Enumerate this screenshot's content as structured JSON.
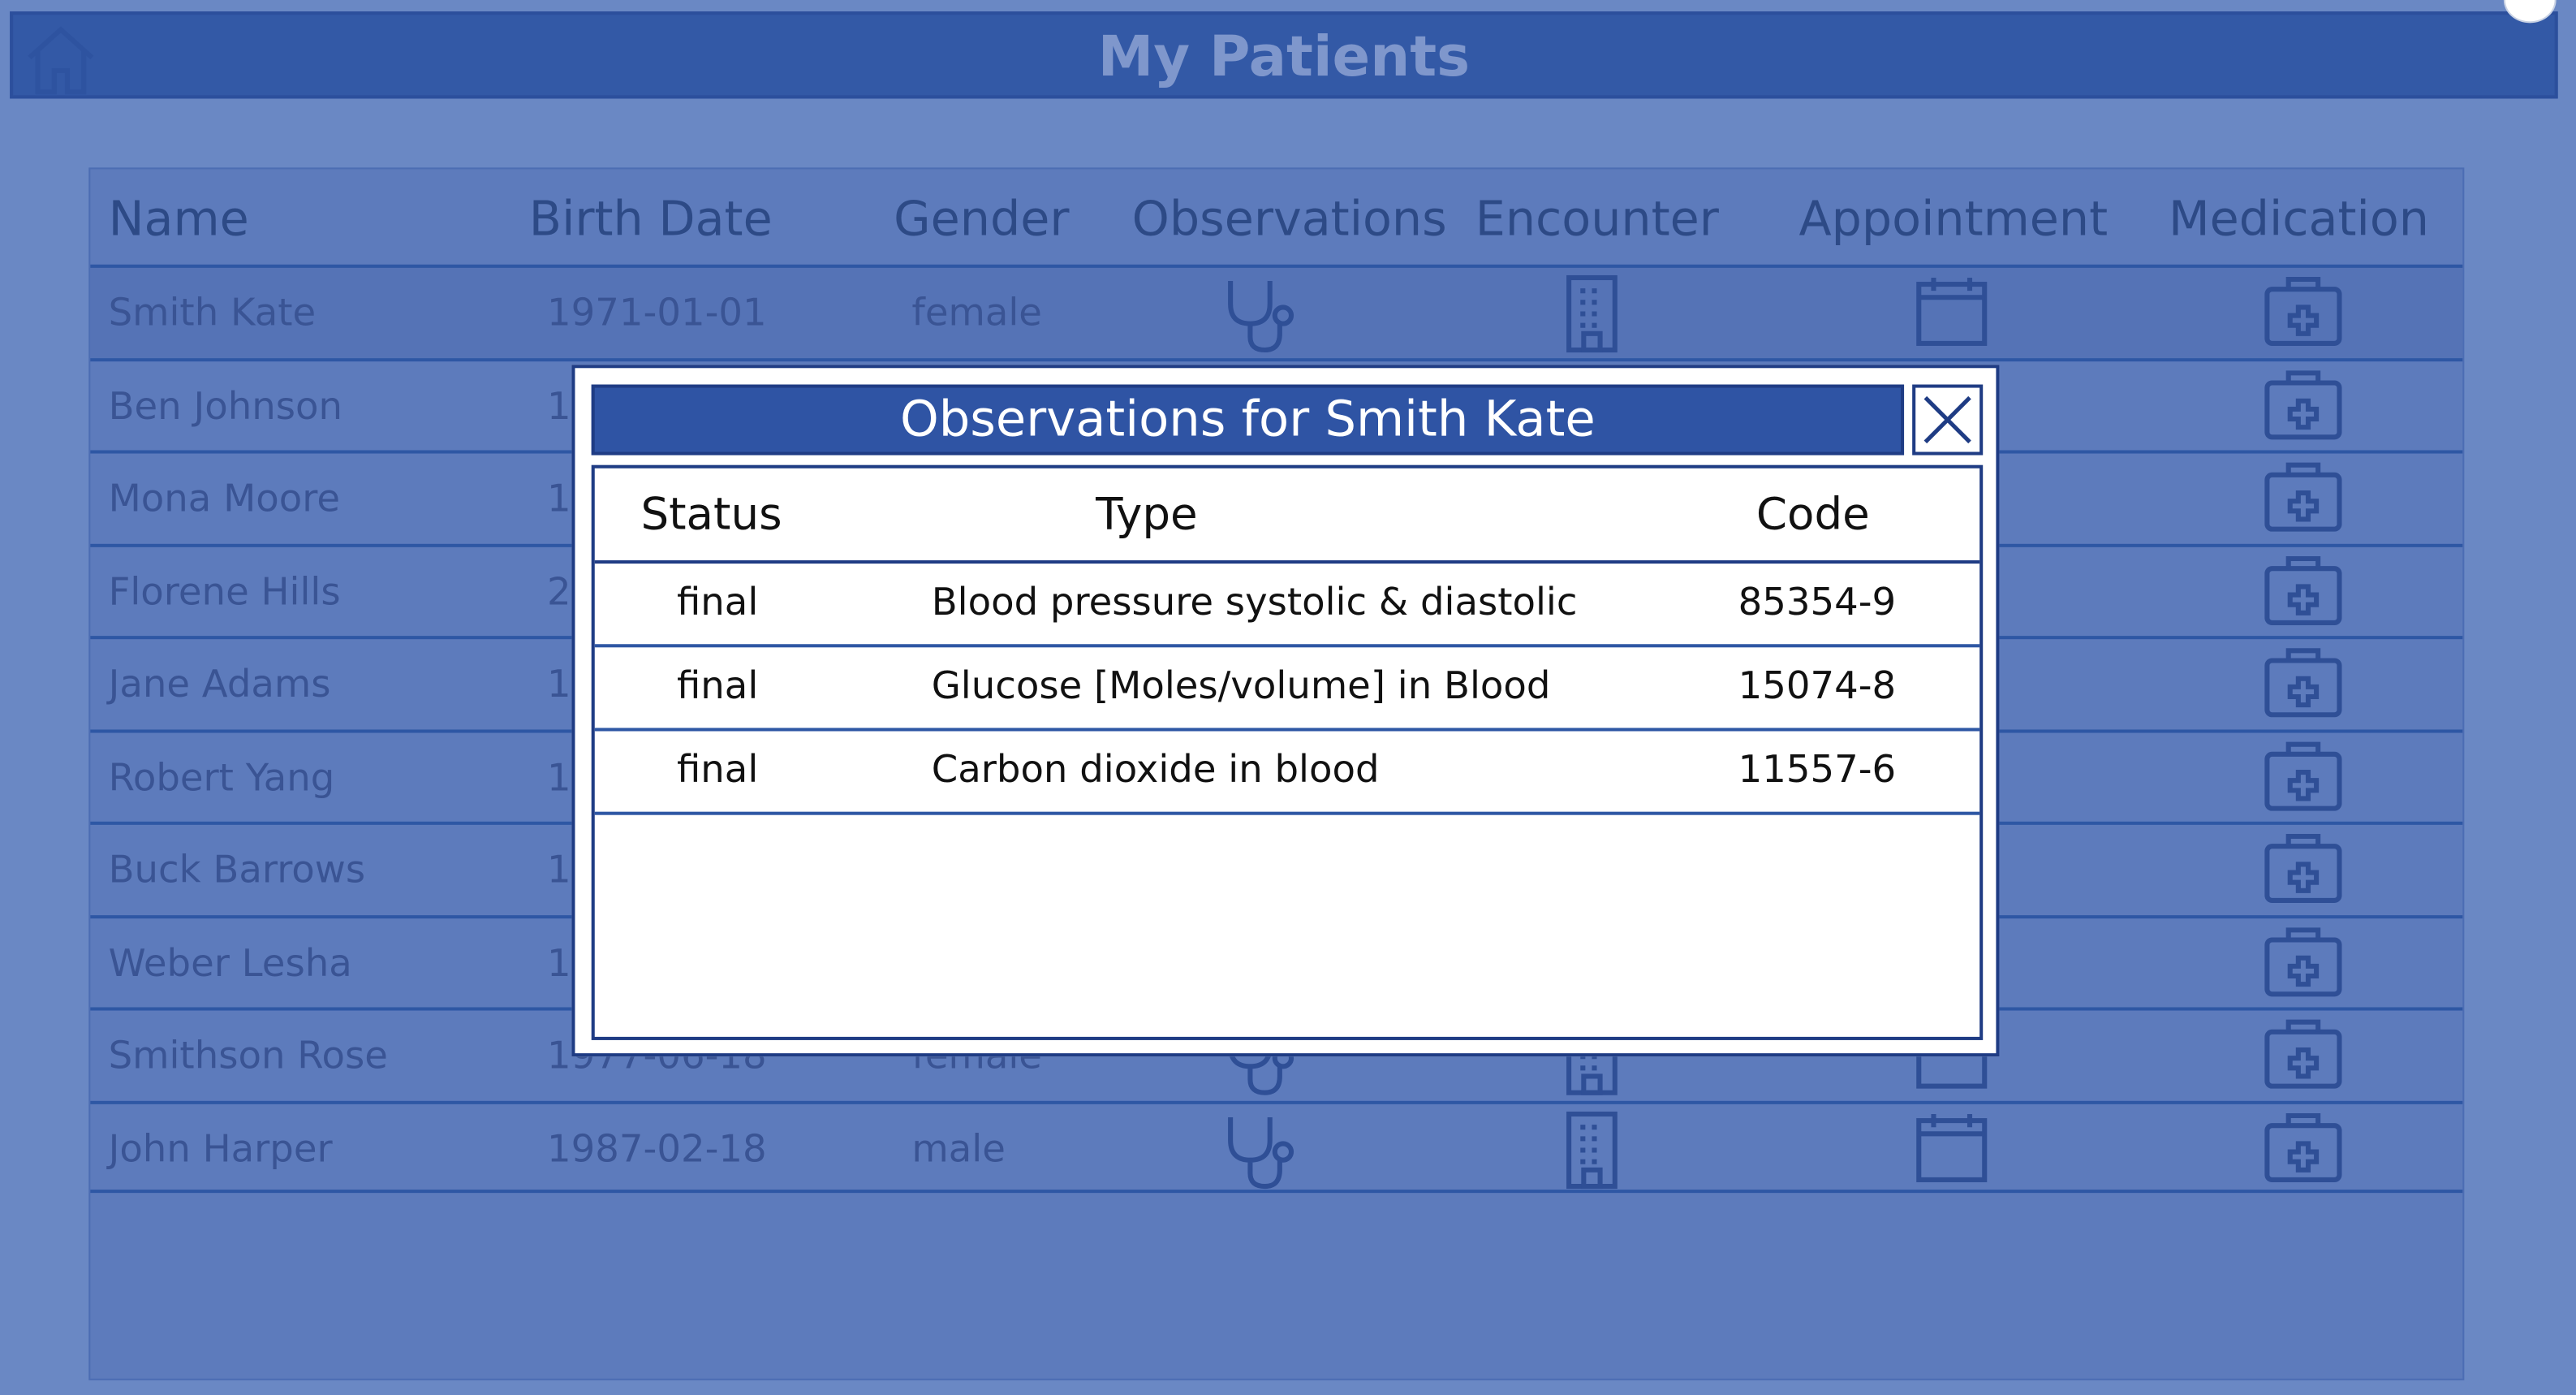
{
  "app": {
    "title": "My Patients"
  },
  "icons": {
    "home": "home-icon",
    "observations": "stethoscope-icon",
    "encounter": "building-icon",
    "appointment": "calendar-icon",
    "medication": "medical-kit-icon",
    "close": "close-icon"
  },
  "colors": {
    "header_bg": "#3359a6",
    "grid_bg": "#5d7bbc",
    "row_line": "#2e57a4",
    "modal_title_bg": "#2f54a4",
    "icon": "#2f4f96"
  },
  "grid": {
    "columns": {
      "name": "Name",
      "birth_date": "Birth Date",
      "gender": "Gender",
      "observations": "Observations",
      "encounter": "Encounter",
      "appointment": "Appointment",
      "medication": "Medication"
    },
    "rows": [
      {
        "name": "Smith Kate",
        "birth_date": "1971-01-01",
        "gender": "female"
      },
      {
        "name": "Ben Johnson",
        "birth_date": "1",
        "gender": ""
      },
      {
        "name": "Mona Moore",
        "birth_date": "1",
        "gender": ""
      },
      {
        "name": "Florene Hills",
        "birth_date": "2",
        "gender": ""
      },
      {
        "name": "Jane Adams",
        "birth_date": "1",
        "gender": ""
      },
      {
        "name": "Robert Yang",
        "birth_date": "1",
        "gender": ""
      },
      {
        "name": "Buck Barrows",
        "birth_date": "1",
        "gender": ""
      },
      {
        "name": "Weber Lesha",
        "birth_date": "1",
        "gender": ""
      },
      {
        "name": "Smithson Rose",
        "birth_date": "1977-06-18",
        "gender": "female"
      },
      {
        "name": "John Harper",
        "birth_date": "1987-02-18",
        "gender": "male"
      }
    ]
  },
  "modal": {
    "title": "Observations for Smith Kate",
    "columns": {
      "status": "Status",
      "type": "Type",
      "code": "Code"
    },
    "rows": [
      {
        "status": "final",
        "type": "Blood pressure systolic & diastolic",
        "code": "85354-9"
      },
      {
        "status": "final",
        "type": "Glucose [Moles/volume] in Blood",
        "code": "15074-8"
      },
      {
        "status": "final",
        "type": "Carbon dioxide in blood",
        "code": "11557-6"
      }
    ]
  }
}
